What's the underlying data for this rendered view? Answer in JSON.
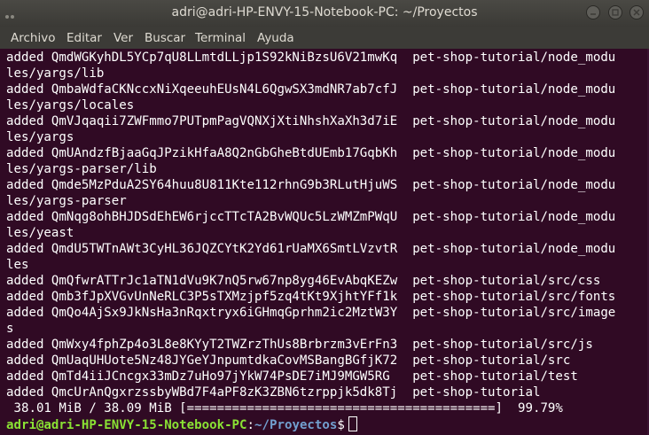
{
  "window": {
    "title": "adri@adri-HP-ENVY-15-Notebook-PC: ~/Proyectos"
  },
  "menu": {
    "items": [
      "Archivo",
      "Editar",
      "Ver",
      "Buscar",
      "Terminal",
      "Ayuda"
    ]
  },
  "terminal": {
    "lines": [
      "added QmdWGKyhDL5YCp7qU8LLmtdLLjp1S92kNiBzsU6V21mwKq  pet-shop-tutorial/node_modu",
      "les/yargs/lib",
      "added QmbaWdfaCKNccxNiXqeeuhEUsN4L6QgwSX3mdNR7ab7cfJ  pet-shop-tutorial/node_modu",
      "les/yargs/locales",
      "added QmVJqaqii7ZWFmmo7PUTpmPagVQNXjXtiNhshXaXh3d7iE  pet-shop-tutorial/node_modu",
      "les/yargs",
      "added QmUAndzfBjaaGqJPzikHfaA8Q2nGbGheBtdUEmb17GqbKh  pet-shop-tutorial/node_modu",
      "les/yargs-parser/lib",
      "added Qmde5MzPduA2SY64huu8U811Kte112rhnG9b3RLutHjuWS  pet-shop-tutorial/node_modu",
      "les/yargs-parser",
      "added QmNqg8ohBHJDSdEhEW6rjccTTcTA2BvWQUc5LzWMZmPWqU  pet-shop-tutorial/node_modu",
      "les/yeast",
      "added QmdU5TWTnAWt3CyHL36JQZCYtK2Yd61rUaMX6SmtLVzvtR  pet-shop-tutorial/node_modu",
      "les",
      "added QmQfwrATTrJc1aTN1dVu9K7nQ5rw67np8yg46EvAbqKEZw  pet-shop-tutorial/src/css",
      "added Qmb3fJpXVGvUnNeRLC3P5sTXMzjpf5zq4tKt9XjhtYFf1k  pet-shop-tutorial/src/fonts",
      "added QmQo4AjSx9JkNsHa3nRqxtryx6iGHmqGprhm2ic2MztW3Y  pet-shop-tutorial/src/image",
      "s",
      "added QmWxy4fphZp4o3L8e8KYyT2TWZrzThUs8Brbrzm3vErFn3  pet-shop-tutorial/src/js",
      "added QmUaqUHUote5Nz48JYGeYJnpumtdkaCovMSBangBGfjK72  pet-shop-tutorial/src",
      "added QmTd4iiJCncgx33mDz7uHo97jYkW74PsDE7iMJ9MGW5RG   pet-shop-tutorial/test",
      "added QmcUrAnQgxrzssbyWBd7F4aPF8zK3ZBN6tzrppjk5dk8Tj  pet-shop-tutorial",
      " 38.01 MiB / 38.09 MiB [=========================================]  99.79%"
    ],
    "prompt": {
      "user_host": "adri@adri-HP-ENVY-15-Notebook-PC",
      "separator": ":",
      "path": "~/Proyectos",
      "symbol": "$"
    },
    "colors": {
      "background": "#300a24",
      "prompt_user": "#8ae234",
      "prompt_path": "#729fcf"
    }
  }
}
